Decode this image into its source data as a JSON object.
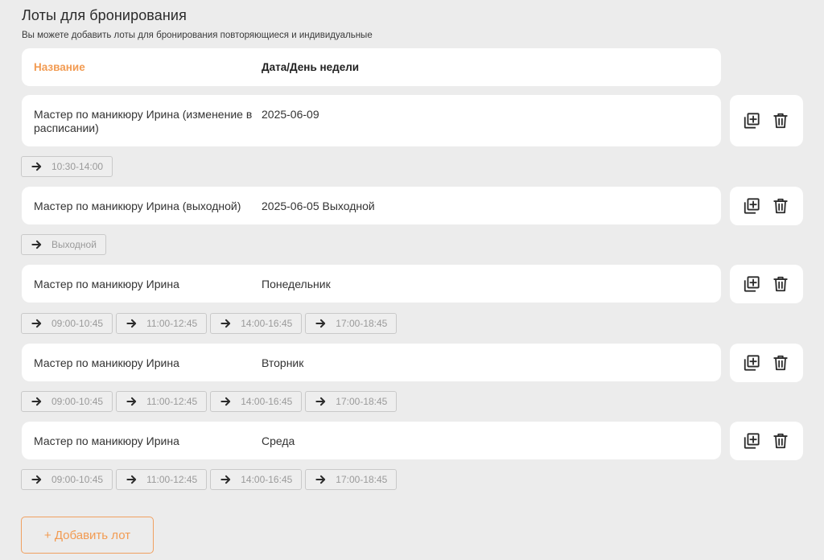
{
  "header": {
    "title": "Лоты для бронирования",
    "subtitle": "Вы можете добавить лоты для бронирования повторяющиеся и индивидуальные"
  },
  "table": {
    "col_name": "Название",
    "col_date": "Дата/День недели"
  },
  "lots": [
    {
      "name": "Мастер по маникюру Ирина (изменение в расписании)",
      "date": "2025-06-09",
      "slots": [
        "10:30-14:00"
      ]
    },
    {
      "name": "Мастер по маникюру Ирина (выходной)",
      "date": "2025-06-05 Выходной",
      "slots": [
        "Выходной"
      ]
    },
    {
      "name": "Мастер по маникюру Ирина",
      "date": "Понедельник",
      "slots": [
        "09:00-10:45",
        "11:00-12:45",
        "14:00-16:45",
        "17:00-18:45"
      ]
    },
    {
      "name": "Мастер по маникюру Ирина",
      "date": "Вторник",
      "slots": [
        "09:00-10:45",
        "11:00-12:45",
        "14:00-16:45",
        "17:00-18:45"
      ]
    },
    {
      "name": "Мастер по маникюру Ирина",
      "date": "Среда",
      "slots": [
        "09:00-10:45",
        "11:00-12:45",
        "14:00-16:45",
        "17:00-18:45"
      ]
    }
  ],
  "icons": {
    "copy": "copy-plus-icon",
    "delete": "trash-icon",
    "slot_arrow": "arrow-right-icon"
  },
  "add_button": "+ Добавить лот",
  "colors": {
    "accent": "#f29b52",
    "background": "#ececec",
    "card": "#ffffff"
  }
}
